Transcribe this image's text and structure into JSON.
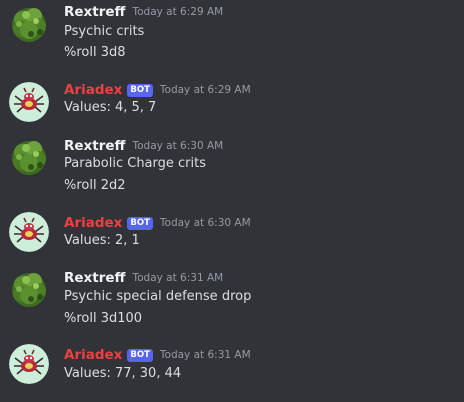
{
  "colors": {
    "background": "#313338",
    "username": "#f2f3f5",
    "bot_username": "#f23f42",
    "bot_tag": "#5865f2",
    "timestamp": "#949ba4",
    "message_text": "#dbdee1"
  },
  "messages": [
    {
      "author": "Rextreff",
      "avatar_icon": "bush-icon",
      "timestamp": "Today at 6:29 AM",
      "lines": [
        "Psychic crits",
        "%roll 3d8"
      ]
    },
    {
      "author": "Ariadex",
      "bot_tag": "BOT",
      "avatar_icon": "ariados-icon",
      "timestamp": "Today at 6:29 AM",
      "lines": [
        "Values: 4, 5, 7"
      ]
    },
    {
      "author": "Rextreff",
      "avatar_icon": "bush-icon",
      "timestamp": "Today at 6:30 AM",
      "lines": [
        "Parabolic Charge crits",
        "%roll 2d2"
      ]
    },
    {
      "author": "Ariadex",
      "bot_tag": "BOT",
      "avatar_icon": "ariados-icon",
      "timestamp": "Today at 6:30 AM",
      "lines": [
        "Values: 2, 1"
      ]
    },
    {
      "author": "Rextreff",
      "avatar_icon": "bush-icon",
      "timestamp": "Today at 6:31 AM",
      "lines": [
        "Psychic special defense drop",
        "%roll 3d100"
      ]
    },
    {
      "author": "Ariadex",
      "bot_tag": "BOT",
      "avatar_icon": "ariados-icon",
      "timestamp": "Today at 6:31 AM",
      "lines": [
        "Values: 77, 30, 44"
      ]
    }
  ]
}
